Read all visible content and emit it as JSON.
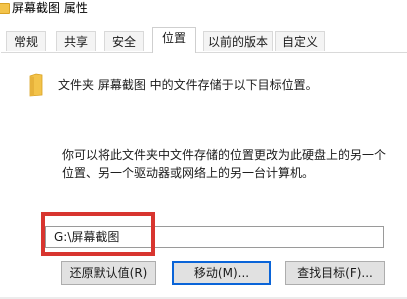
{
  "window": {
    "title": "屏幕截图 属性"
  },
  "tabs": [
    {
      "label": "常规"
    },
    {
      "label": "共享"
    },
    {
      "label": "安全"
    },
    {
      "label": "位置"
    },
    {
      "label": "以前的版本"
    },
    {
      "label": "自定义"
    }
  ],
  "active_tab": "位置",
  "location": {
    "info": "文件夹 屏幕截图 中的文件存储于以下目标位置。",
    "description_line1": "你可以将此文件夹中文件存储的位置更改为此硬盘上的另一个",
    "description_line2": "位置、另一个驱动器或网络上的另一台计算机。",
    "path": "G:\\屏幕截图"
  },
  "buttons": {
    "restore_default": "还原默认值(R)",
    "move": "移动(M)...",
    "find_target": "查找目标(F)..."
  },
  "colors": {
    "highlight": "#d8352f",
    "focus_border": "#0a64d8",
    "folder": "#f3c34a"
  }
}
